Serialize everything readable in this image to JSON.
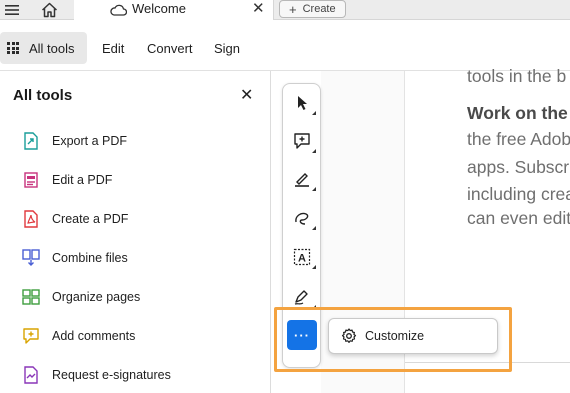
{
  "tabbar": {
    "tab_title": "Welcome",
    "close_glyph": "✕",
    "create_label": "Create",
    "icons": [
      "hamburger-menu-icon",
      "home-icon",
      "star-icon",
      "cloud-icon"
    ]
  },
  "menu": {
    "all_tools": "All tools",
    "edit": "Edit",
    "convert": "Convert",
    "sign": "Sign"
  },
  "panel": {
    "title": "All tools",
    "close_glyph": "✕",
    "tools": [
      {
        "label": "Export a PDF",
        "icon": "export-pdf-icon",
        "color": "#1a9e9a"
      },
      {
        "label": "Edit a PDF",
        "icon": "edit-pdf-icon",
        "color": "#c8327d"
      },
      {
        "label": "Create a PDF",
        "icon": "create-pdf-icon",
        "color": "#e0393e"
      },
      {
        "label": "Combine files",
        "icon": "combine-files-icon",
        "color": "#4a5fd4"
      },
      {
        "label": "Organize pages",
        "icon": "organize-pages-icon",
        "color": "#3e9e3e"
      },
      {
        "label": "Add comments",
        "icon": "add-comments-icon",
        "color": "#d9a400"
      },
      {
        "label": "Request e-signatures",
        "icon": "request-esignatures-icon",
        "color": "#8a36b8"
      }
    ]
  },
  "toolbar": {
    "tools": [
      "select-cursor-icon",
      "add-comment-icon",
      "highlight-pen-icon",
      "draw-freehand-icon",
      "text-recognition-icon",
      "sign-pen-icon"
    ],
    "more_glyph": "···"
  },
  "popup": {
    "customize_label": "Customize"
  },
  "document": {
    "line1": "tools in the b",
    "heading": "Work on the",
    "line2": "the free Adob",
    "line3": "apps. Subscri",
    "line4": "including crea",
    "line5": "can even edit"
  },
  "colors": {
    "accent": "#1473e6",
    "highlight": "#f4a340"
  }
}
